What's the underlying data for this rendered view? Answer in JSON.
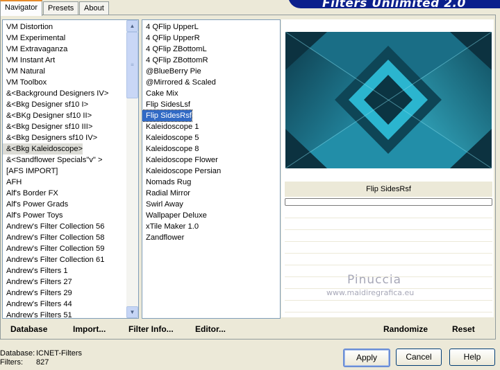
{
  "tabs": [
    "Navigator",
    "Presets",
    "About"
  ],
  "banner": "Filters Unlimited 2.0",
  "categories": [
    "VM Distortion",
    "VM Experimental",
    "VM Extravaganza",
    "VM Instant Art",
    "VM Natural",
    "VM Toolbox",
    "&<Background Designers IV>",
    "&<Bkg Designer sf10 I>",
    "&<BKg Designer sf10 II>",
    "&<Bkg Designer sf10 III>",
    "&<Bkg Designers sf10 IV>",
    "&<Bkg Kaleidoscope>",
    "&<Sandflower Specials\"v\" >",
    "[AFS IMPORT]",
    "AFH",
    "Alf's Border FX",
    "Alf's Power Grads",
    "Alf's Power Toys",
    "Andrew's Filter Collection 56",
    "Andrew's Filter Collection 58",
    "Andrew's Filter Collection 59",
    "Andrew's Filter Collection 61",
    "Andrew's Filters 1",
    "Andrew's Filters 27",
    "Andrew's Filters 29",
    "Andrew's Filters 44",
    "Andrew's Filters 51"
  ],
  "selected_category": "&<Bkg Kaleidoscope>",
  "filters": [
    "4 QFlip UpperL",
    "4 QFlip UpperR",
    "4 QFlip ZBottomL",
    "4 QFlip ZBottomR",
    "@BlueBerry Pie",
    "@Mirrored & Scaled",
    "Cake Mix",
    "Flip SidesLsf",
    "Flip SidesRsf",
    "Kaleidoscope 1",
    "Kaleidoscope 5",
    "Kaleidoscope 8",
    "Kaleidoscope Flower",
    "Kaleidoscope Persian",
    "Nomads Rug",
    "Radial Mirror",
    "Swirl Away",
    "Wallpaper Deluxe",
    "xTile Maker 1.0",
    "Zandflower"
  ],
  "selected_filter": "Flip SidesRsf",
  "preview": {
    "filter_name": "Flip SidesRsf",
    "progress": 0
  },
  "watermark": {
    "name": "Pinuccia",
    "url": "www.maidiregrafica.eu"
  },
  "bottom_links": [
    "Database",
    "Import...",
    "Filter Info...",
    "Editor..."
  ],
  "preview_actions": [
    "Randomize",
    "Reset"
  ],
  "status": {
    "database_label": "Database:",
    "database_value": "ICNET-Filters",
    "filters_label": "Filters:",
    "filters_value": "827"
  },
  "buttons": {
    "apply": "Apply",
    "cancel": "Cancel",
    "help": "Help"
  },
  "colors": {
    "selection": "#316ac5",
    "banner": "#0b1f8c",
    "preview_teal": "#1b8aa5"
  }
}
